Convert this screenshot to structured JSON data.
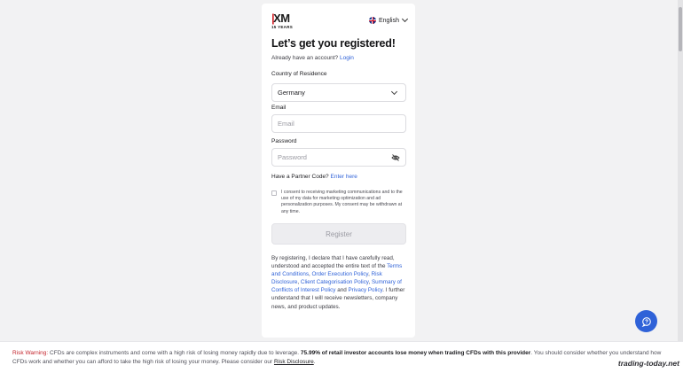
{
  "header": {
    "logo_text": "XM",
    "logo_sub": "15 YEARS",
    "language": "English"
  },
  "form": {
    "title": "Let’s get you registered!",
    "already_text": "Already have an account?",
    "login_link": "Login",
    "country_label": "Country of Residence",
    "country_value": "Germany",
    "email_label": "Email",
    "email_placeholder": "Email",
    "password_label": "Password",
    "password_placeholder": "Password",
    "partner_text": "Have a Partner Code?",
    "partner_link": "Enter here",
    "consent_text": "I consent to receiving marketing communications and to the use of my data for marketing optimization and ad personalization purposes. My consent may be withdrawn at any time.",
    "register_label": "Register"
  },
  "legal": {
    "intro": "By registering, I declare that I have carefully read, understood and accepted the entire text of the",
    "terms": "Terms and Conditions",
    "sep1": ",",
    "order": "Order Execution Policy",
    "sep2": ",",
    "risk": "Risk Disclosure",
    "sep3": ",",
    "client": "Client Categorisation Policy",
    "sep4": ",",
    "conflicts": "Summary of Conflicts of Interest Policy",
    "and": "and",
    "privacy": "Privacy Policy",
    "outro": ". I further understand that I will receive newsletters, company news, and product updates."
  },
  "footer": {
    "risk_label": "Risk Warning:",
    "risk_text1": "CFDs are complex instruments and come with a high risk of losing money rapidly due to leverage.",
    "risk_bold": "75.99% of retail investor accounts lose money when trading CFDs with this provider",
    "risk_text2": ". You should consider whether you understand how CFDs work and whether you can afford to take the high risk of losing your money. Please consider our",
    "risk_link": "Risk Disclosure",
    "risk_end": "."
  },
  "watermark": "trading-today.net",
  "colors": {
    "accent": "#2f62d8",
    "brand_red": "#d4242b",
    "background": "#f2f2f3"
  }
}
